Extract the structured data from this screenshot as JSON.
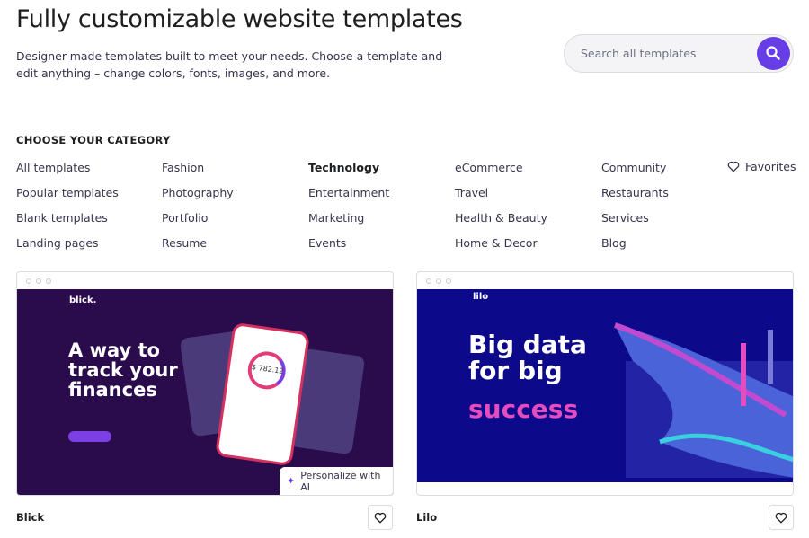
{
  "header": {
    "title": "Fully customizable website templates",
    "subtitle": "Designer-made templates built to meet your needs. Choose a template and edit anything – change colors, fonts, images, and more.",
    "search_placeholder": "Search all templates"
  },
  "categories": {
    "heading": "CHOOSE YOUR CATEGORY",
    "columns": [
      [
        "All templates",
        "Popular templates",
        "Blank templates",
        "Landing pages"
      ],
      [
        "Fashion",
        "Photography",
        "Portfolio",
        "Resume"
      ],
      [
        "Technology",
        "Entertainment",
        "Marketing",
        "Events"
      ],
      [
        "eCommerce",
        "Travel",
        "Health & Beauty",
        "Home & Decor"
      ],
      [
        "Community",
        "Restaurants",
        "Services",
        "Blog"
      ]
    ],
    "selected": "Technology",
    "favorites": "Favorites"
  },
  "templates": [
    {
      "name": "Blick",
      "logo": "blick.",
      "headline": "A way to track your finances",
      "balance": "$ 782.12",
      "bg": "#2a0b4c",
      "personalize": "Personalize with AI"
    },
    {
      "name": "Lilo",
      "logo": "lilo",
      "headline1": "Big data for big",
      "headline2": "success",
      "bg": "#0c0a8a",
      "accent": "#e54cbf"
    }
  ],
  "colors": {
    "accent": "#673de6"
  }
}
